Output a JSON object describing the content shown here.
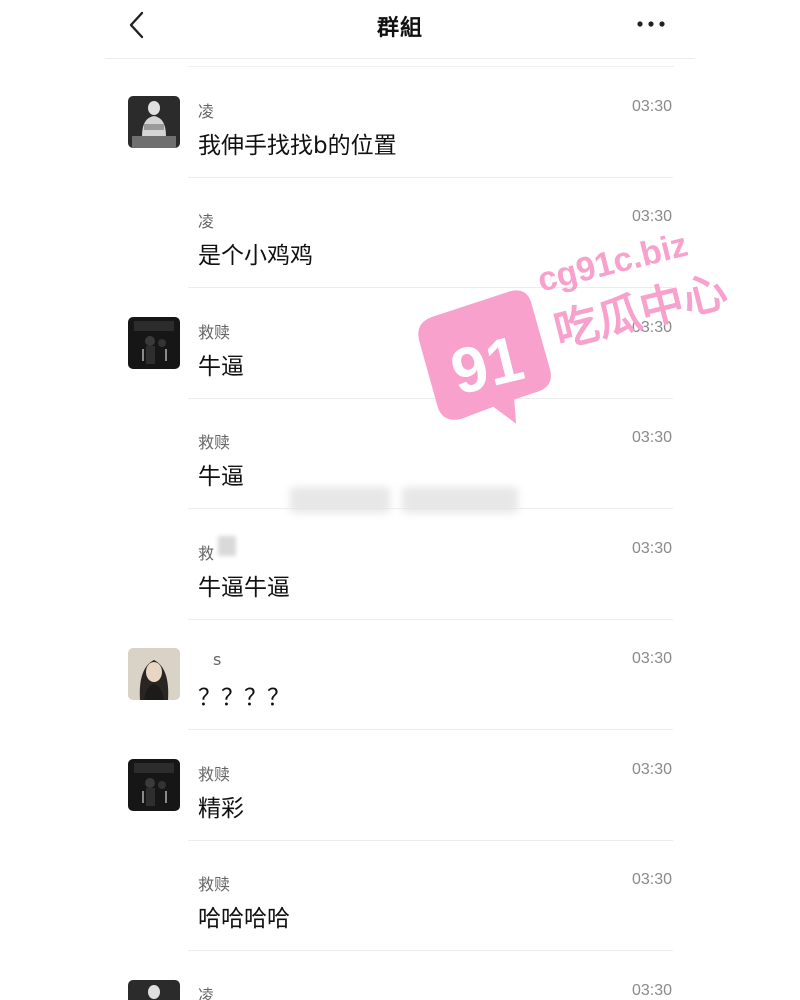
{
  "header": {
    "title": "群組",
    "back_icon": "chevron-left-icon",
    "more_icon": "more-horizontal-icon"
  },
  "messages": [
    {
      "sender": "凌",
      "time": "03:30",
      "text": "我伸手找找b的位置",
      "avatar": "statue-avatar"
    },
    {
      "sender": "凌",
      "time": "03:30",
      "text": "是个小鸡鸡",
      "avatar": null
    },
    {
      "sender": "救赎",
      "time": "03:30",
      "text": "牛逼",
      "avatar": "dark-room-avatar"
    },
    {
      "sender": "救赎",
      "time": "03:30",
      "text": "牛逼",
      "avatar": null
    },
    {
      "sender": "救",
      "time": "03:30",
      "text": "牛逼牛逼",
      "avatar": null
    },
    {
      "sender": "s",
      "time": "03:30",
      "text": "？？？？",
      "avatar": "girl-avatar"
    },
    {
      "sender": "救赎",
      "time": "03:30",
      "text": "精彩",
      "avatar": "dark-room-avatar"
    },
    {
      "sender": "救赎",
      "time": "03:30",
      "text": "哈哈哈哈",
      "avatar": null
    },
    {
      "sender": "凌",
      "time": "03:30",
      "text": "",
      "avatar": "statue-avatar"
    }
  ],
  "watermark": {
    "badge": "91",
    "domain": "cg91c.biz",
    "name": "吃瓜中心",
    "color": "#f7a1cc"
  }
}
